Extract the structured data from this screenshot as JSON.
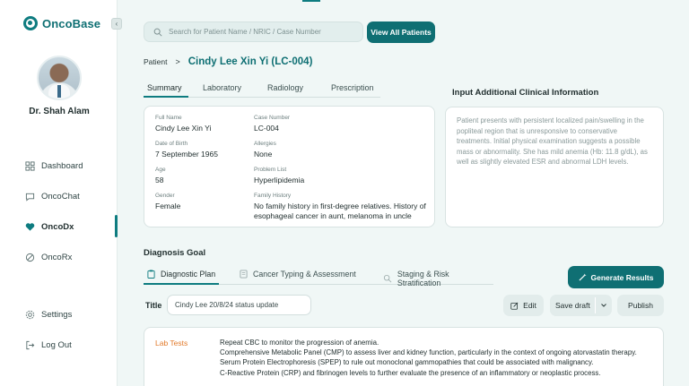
{
  "app": {
    "name": "OncoBase",
    "collapse_icon": "chevron-left-icon"
  },
  "user": {
    "name": "Dr. Shah Alam"
  },
  "sidebar": {
    "items": [
      {
        "label": "Dashboard",
        "icon": "grid-icon"
      },
      {
        "label": "OncoChat",
        "icon": "chat-bubble-icon"
      },
      {
        "label": "OncoDx",
        "icon": "heart-icon",
        "active": true
      },
      {
        "label": "OncoRx",
        "icon": "pill-icon"
      }
    ],
    "bottom": [
      {
        "label": "Settings",
        "icon": "gear-icon"
      },
      {
        "label": "Log Out",
        "icon": "logout-icon"
      }
    ]
  },
  "search": {
    "placeholder": "Search for Patient Name / NRIC / Case Number",
    "value": ""
  },
  "header": {
    "view_all_label": "View All Patients"
  },
  "breadcrumb": {
    "label": "Patient",
    "separator": ">",
    "patient": "Cindy Lee Xin Yi (LC-004)"
  },
  "tabs": [
    "Summary",
    "Laboratory",
    "Radiology",
    "Prescription"
  ],
  "patient": {
    "full_name_label": "Full Name",
    "full_name": "Cindy Lee Xin Yi",
    "case_label": "Case Number",
    "case": "LC-004",
    "dob_label": "Date of Birth",
    "dob": "7 September 1965",
    "allergies_label": "Allergies",
    "allergies": "None",
    "age_label": "Age",
    "age": "58",
    "problem_label": "Problem List",
    "problem": "Hyperlipidemia",
    "gender_label": "Gender",
    "gender": "Female",
    "family_label": "Family History",
    "family": "No family history in first-degree relatives. History of esophageal cancer in aunt, melanoma in uncle"
  },
  "clinical": {
    "title": "Input Additional Clinical Information",
    "placeholder": "Patient presents with persistent localized pain/swelling in the popliteal region that is unresponsive to conservative treatments. Initial physical examination suggests a possible mass or abnormality. She has mild anemia (Hb: 11.8 g/dL), as well as slightly elevated ESR and abnormal LDH levels."
  },
  "diagnosis": {
    "title": "Diagnosis Goal",
    "tabs": [
      {
        "label": "Diagnostic Plan",
        "icon": "clipboard-icon"
      },
      {
        "label": "Cancer Typing & Assessment",
        "icon": "document-icon"
      },
      {
        "label": "Staging & Risk Stratification",
        "icon": "magnifier-icon"
      }
    ],
    "generate_label": "Generate Results",
    "title_label": "Title",
    "title_value": "Cindy Lee 20/8/24 status update",
    "edit_label": "Edit",
    "save_draft_label": "Save draft",
    "publish_label": "Publish",
    "lab_tests_label": "Lab Tests",
    "lab_tests": [
      "Repeat CBC to monitor the progression of anemia.",
      "Comprehensive Metabolic Panel (CMP) to assess liver and kidney function, particularly in the context of ongoing atorvastatin therapy.",
      "Serum Protein Electrophoresis (SPEP) to rule out monoclonal gammopathies that could be associated with malignancy.",
      "C-Reactive Protein (CRP) and fibrinogen levels to further evaluate the presence of an inflammatory or neoplastic process."
    ]
  },
  "colors": {
    "accent": "#0e7c80",
    "lab_label": "#e27a2a",
    "background": "#f0f7f6"
  }
}
